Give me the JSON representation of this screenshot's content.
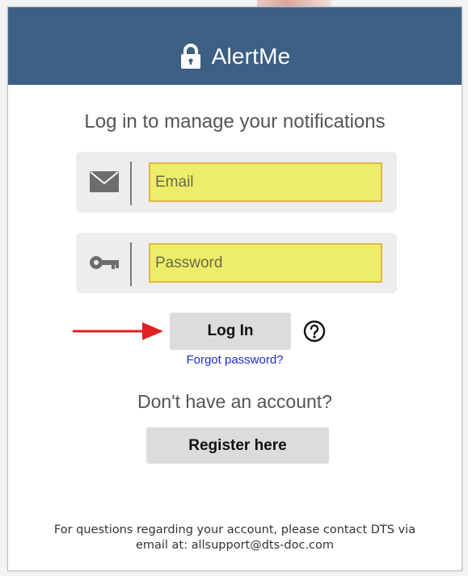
{
  "header": {
    "icon": "lock-icon",
    "title": "AlertMe",
    "background_color": "#3e5f84"
  },
  "login": {
    "subtitle": "Log in to manage your notifications",
    "email": {
      "icon": "envelope-icon",
      "placeholder": "Email",
      "value": ""
    },
    "password": {
      "icon": "key-icon",
      "placeholder": "Password",
      "value": ""
    },
    "login_button": "Log In",
    "help_icon": "question-circle-icon",
    "annotation_icon": "red-arrow-icon",
    "forgot_password": "Forgot password?"
  },
  "register": {
    "prompt": "Don't have an account?",
    "button": "Register here"
  },
  "footer": {
    "line1": "For questions regarding your account, please contact DTS via",
    "line2": "email at: allsupport@dts-doc.com"
  },
  "colors": {
    "input_highlight": "#eded6a",
    "input_border": "#e0b84a",
    "link": "#1a2cd6",
    "annotation_arrow": "#e02020"
  }
}
